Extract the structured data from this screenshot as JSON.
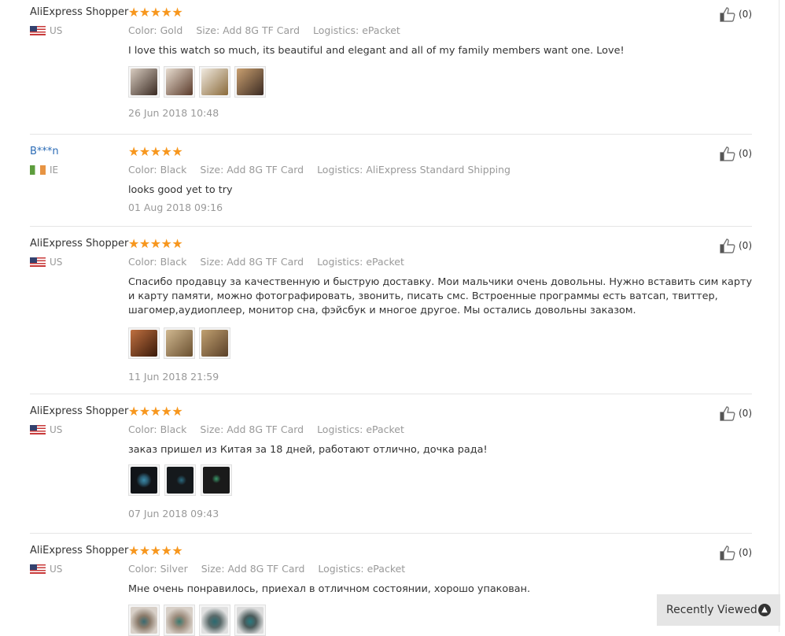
{
  "reviews": [
    {
      "user": "AliExpress Shopper",
      "country": "US",
      "flag": "us",
      "stars": "★★★★★",
      "attrs": [
        "Color: Gold",
        "Size: Add 8G TF Card",
        "Logistics: ePacket"
      ],
      "text": "I love this watch so much, its beautiful and elegant and all of my family members want one. Love!",
      "photos": [
        "#c8bcb0",
        "#6a4a3a",
        "#9a7a5a",
        "#8a6a4a"
      ],
      "date": "26 Jun 2018 10:48",
      "helpful": "(0)"
    },
    {
      "user": "B***n",
      "country": "IE",
      "flag": "ie",
      "stars": "★★★★★",
      "attrs": [
        "Color: Black",
        "Size: Add 8G TF Card",
        "Logistics: AliExpress Standard Shipping"
      ],
      "text": "looks good yet to try",
      "photos": [],
      "date": "01 Aug 2018 09:16",
      "helpful": "(0)"
    },
    {
      "user": "AliExpress Shopper",
      "country": "US",
      "flag": "us",
      "stars": "★★★★★",
      "attrs": [
        "Color: Black",
        "Size: Add 8G TF Card",
        "Logistics: ePacket"
      ],
      "text": "Спасибо продавцу за качественную и быструю доставку. Мои мальчики очень довольны. Нужно вставить сим карту и карту памяти, можно фотографировать, звонить, писать смс. Встроенные программы есть ватсап, твиттер, шагомер,аудиоплеер, монитор сна, фэйсбук и многое другое. Мы остались довольны заказом.",
      "photos": [
        "#8a4a2a",
        "#b89a6a",
        "#9a7a5a"
      ],
      "date": "11 Jun 2018 21:59",
      "helpful": "(0)"
    },
    {
      "user": "AliExpress Shopper",
      "country": "US",
      "flag": "us",
      "stars": "★★★★★",
      "attrs": [
        "Color: Black",
        "Size: Add 8G TF Card",
        "Logistics: ePacket"
      ],
      "text": "заказ пришел из Китая за 18 дней, работают отлично, дочка рада!",
      "photos": [
        "#111418",
        "#15191c",
        "#1a1a1a"
      ],
      "date": "07 Jun 2018 09:43",
      "helpful": "(0)"
    },
    {
      "user": "AliExpress Shopper",
      "country": "US",
      "flag": "us",
      "stars": "★★★★★",
      "attrs": [
        "Color: Silver",
        "Size: Add 8G TF Card",
        "Logistics: ePacket"
      ],
      "text": "Мне очень понравилось, приехал в отличном состоянии, хорошо упакован.",
      "photos": [
        "#8a7a6a",
        "#9a8a7a",
        "#7a8a8a",
        "#6a7a7a"
      ],
      "date": "",
      "helpful": "(0)"
    }
  ],
  "recently_viewed": {
    "label": "Recently Viewed",
    "icon": "chevron-up-icon"
  },
  "colors": {
    "star": "#f7971e",
    "meta_gray": "#999999",
    "masked_user": "#2c6cb6",
    "panel_bg": "#e5e5e5"
  }
}
